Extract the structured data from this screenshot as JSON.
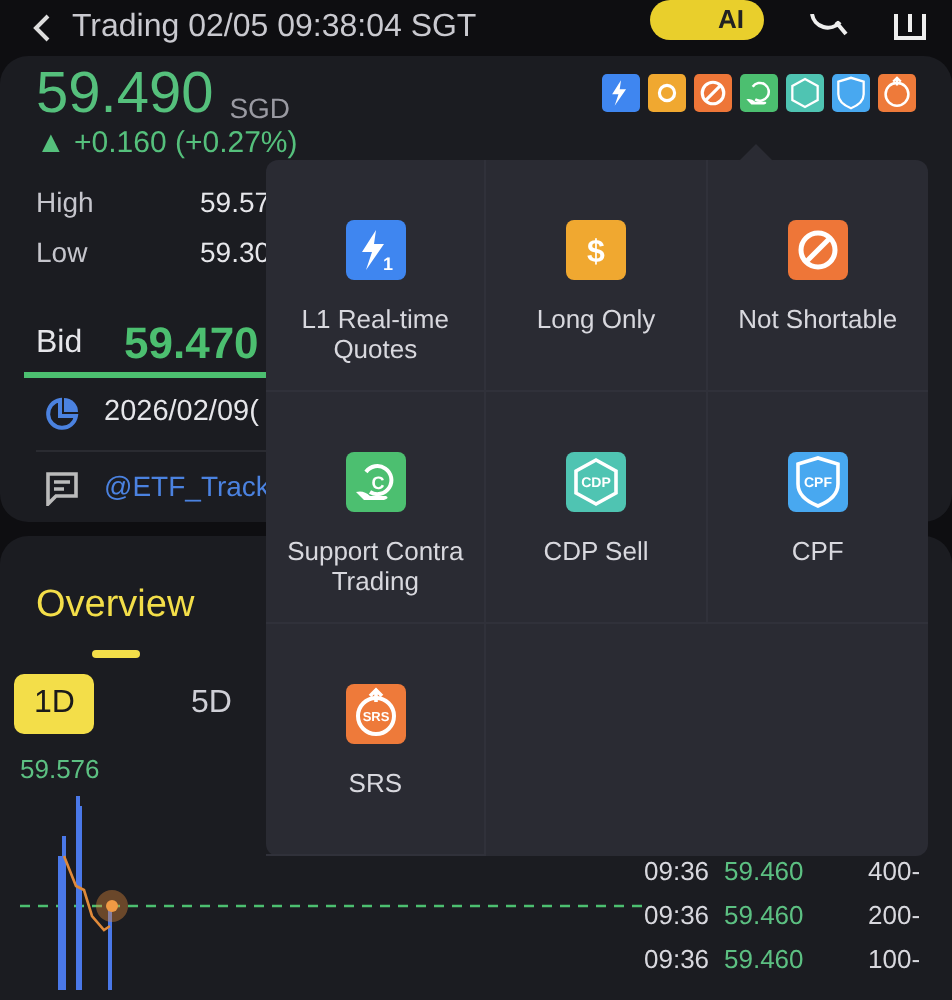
{
  "header": {
    "title": "Trading 02/05 09:38:04 SGT",
    "ai_button": "AI"
  },
  "quote": {
    "price": "59.490",
    "currency": "SGD",
    "change": "▲ +0.160 (+0.27%)",
    "badges": [
      {
        "kind": "realtime",
        "color": "#3f86f0"
      },
      {
        "kind": "long",
        "color": "#f0a830"
      },
      {
        "kind": "noshort",
        "color": "#ee7638"
      },
      {
        "kind": "contra",
        "color": "#4cbf70"
      },
      {
        "kind": "cdp",
        "color": "#4fc4b2"
      },
      {
        "kind": "cpf",
        "color": "#48a8f0"
      },
      {
        "kind": "srs",
        "color": "#ee7a3a"
      }
    ],
    "stats": [
      {
        "label": "High",
        "value": "59.57"
      },
      {
        "label": "Low",
        "value": "59.30"
      }
    ],
    "bid": {
      "label": "Bid",
      "value": "59.470"
    },
    "date": "2026/02/09(",
    "comment": "@ETF_Track"
  },
  "tabs": [
    {
      "label": "Overview",
      "selected": true
    }
  ],
  "periods": [
    {
      "label": "1D",
      "selected": true
    },
    {
      "label": "5D",
      "selected": false
    }
  ],
  "chart": {
    "top_label": "59.576"
  },
  "ticks": [
    {
      "time": "09:36",
      "price": "59.460",
      "volume": "400-"
    },
    {
      "time": "09:36",
      "price": "59.460",
      "volume": "200-"
    },
    {
      "time": "09:36",
      "price": "59.460",
      "volume": "100-"
    }
  ],
  "popup": {
    "items": [
      {
        "kind": "realtime",
        "label": "L1 Real-time Quotes",
        "color": "#3f86f0",
        "glyph": "1"
      },
      {
        "kind": "long",
        "label": "Long Only",
        "color": "#f0a830",
        "glyph": "$"
      },
      {
        "kind": "noshort",
        "label": "Not Shortable",
        "color": "#ee7638"
      },
      {
        "kind": "contra",
        "label": "Support Contra Trading",
        "color": "#4cbf70",
        "glyph": "C"
      },
      {
        "kind": "cdp",
        "label": "CDP Sell",
        "color": "#4fc4b2",
        "glyph": "CDP"
      },
      {
        "kind": "cpf",
        "label": "CPF",
        "color": "#48a8f0",
        "glyph": "CPF"
      },
      {
        "kind": "srs",
        "label": "SRS",
        "color": "#ee7a3a",
        "glyph": "SRS"
      }
    ]
  }
}
